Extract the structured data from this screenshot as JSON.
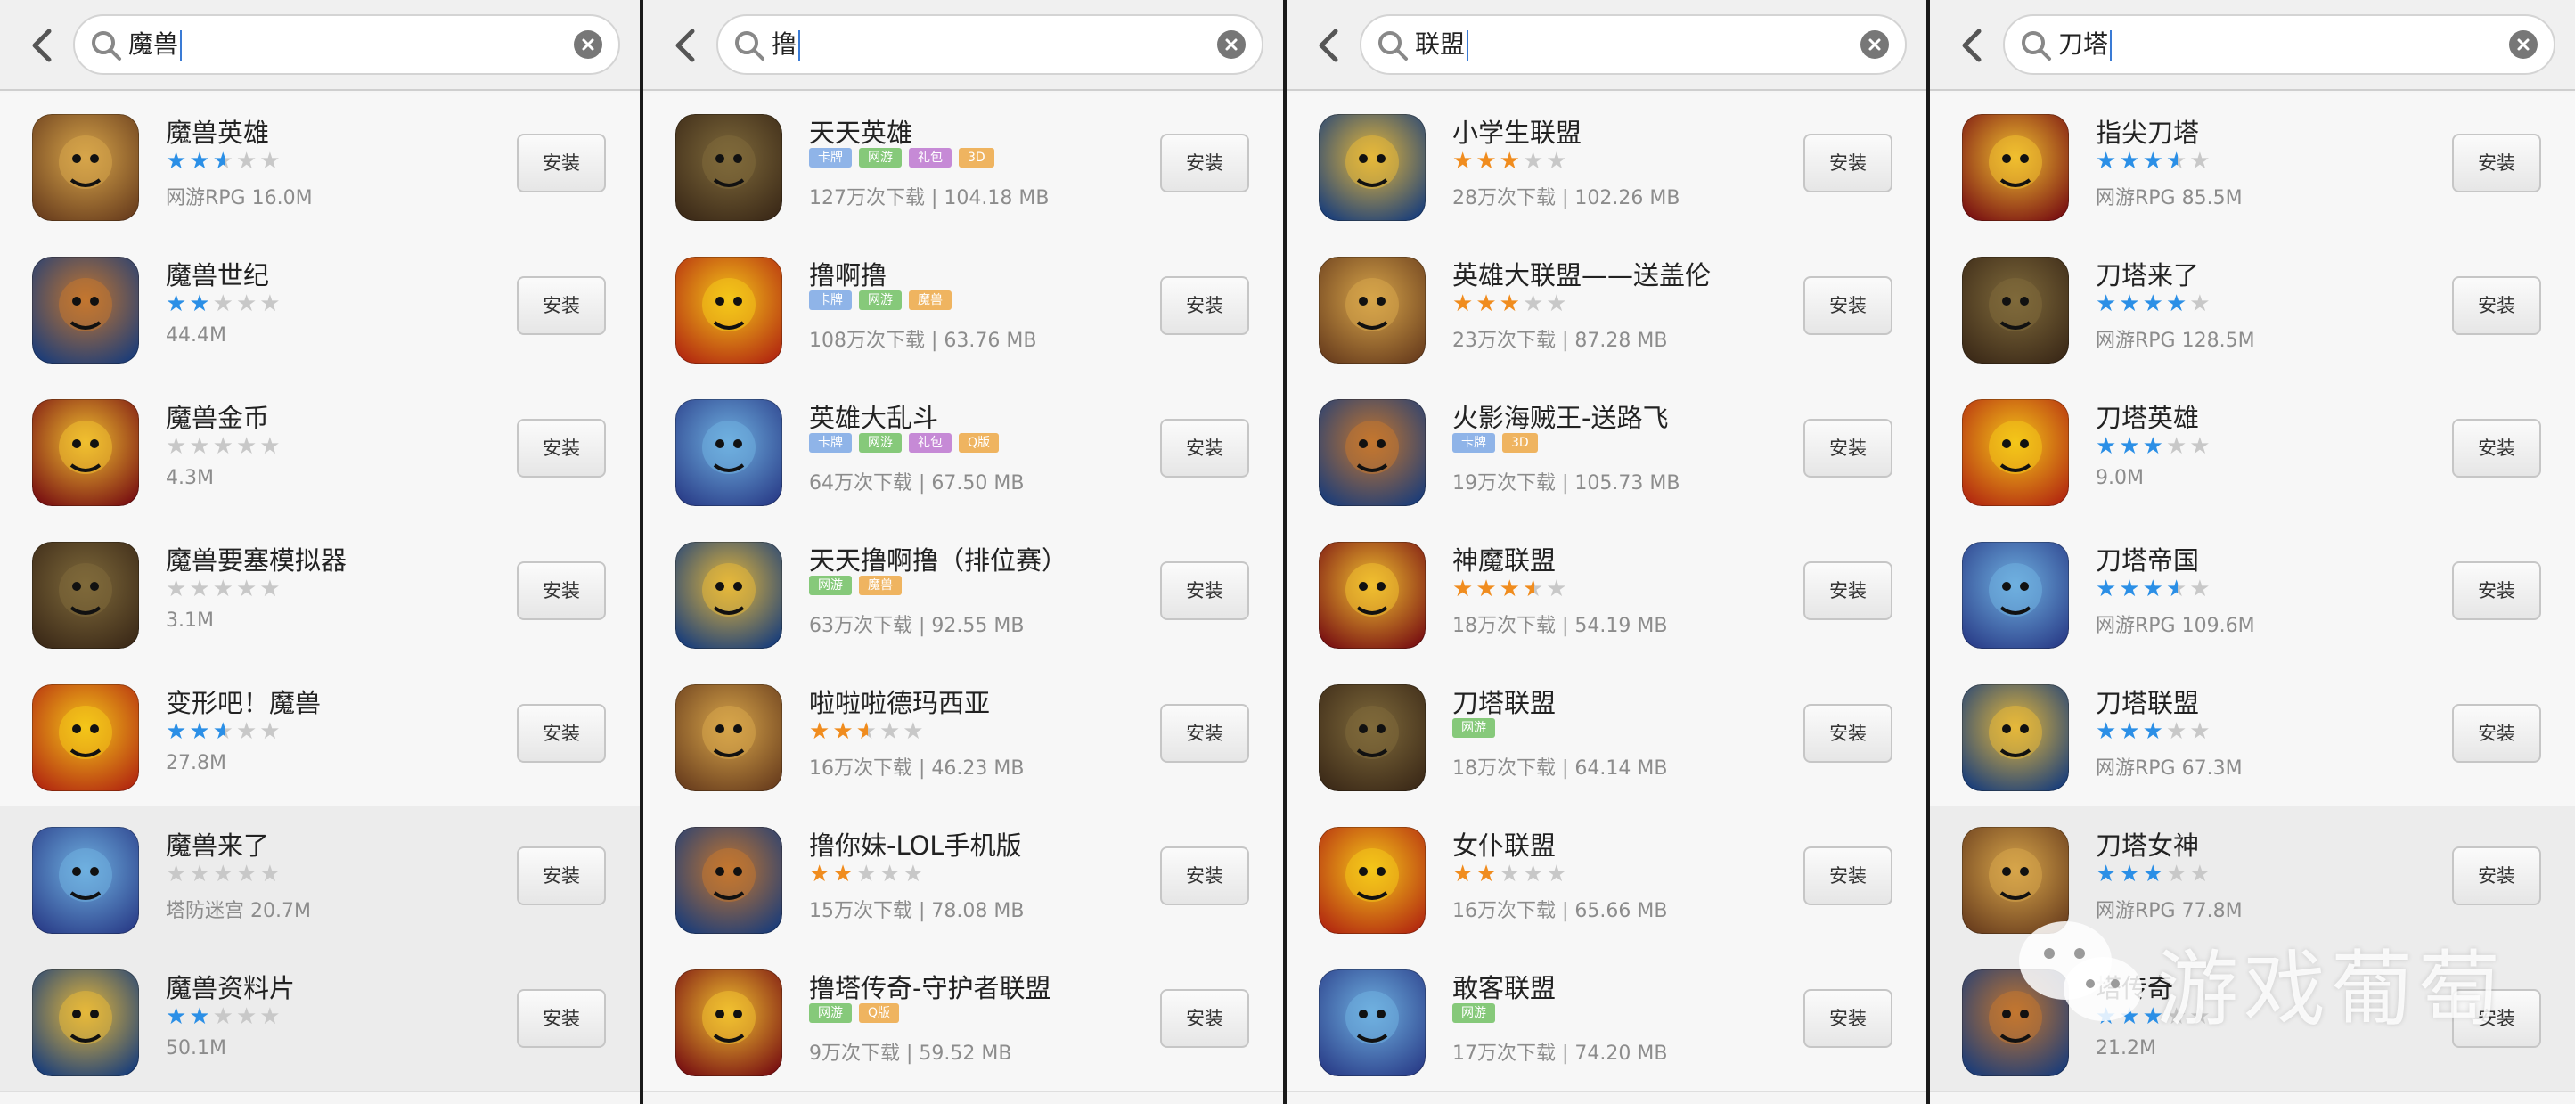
{
  "install_label": "安装",
  "colors": {
    "star_blue": "#2b8fe6",
    "star_orange": "#f08c1e",
    "star_empty": "#c8c8c8",
    "tag_blue": "#8fb4e8",
    "tag_green": "#86c97a",
    "tag_purple": "#c68ad6",
    "tag_orange": "#efb460"
  },
  "panels": [
    {
      "query": "魔兽",
      "items": [
        {
          "name": "魔兽英雄",
          "rating": 2.5,
          "meta": "网游RPG 16.0M",
          "tags": [],
          "icon": "panda-warrior-icon"
        },
        {
          "name": "魔兽世纪",
          "rating": 2,
          "meta": "44.4M",
          "tags": [],
          "icon": "armored-hero-icon"
        },
        {
          "name": "魔兽金币",
          "rating": 0,
          "meta": "4.3M",
          "tags": [],
          "icon": "gold-coin-icon"
        },
        {
          "name": "魔兽要塞模拟器",
          "rating": 0,
          "meta": "3.1M",
          "tags": [],
          "icon": "fortress-icon"
        },
        {
          "name": "变形吧！魔兽",
          "rating": 2.5,
          "meta": "27.8M",
          "tags": [],
          "icon": "dragon-eye-icon"
        },
        {
          "name": "魔兽来了",
          "rating": 0,
          "meta": "塔防迷宫 20.7M",
          "tags": [],
          "icon": "werewolf-icon"
        },
        {
          "name": "魔兽资料片",
          "rating": 2,
          "meta": "50.1M",
          "tags": [],
          "icon": "warcraft-w-icon"
        }
      ]
    },
    {
      "query": "撸",
      "items": [
        {
          "name": "天天英雄",
          "rating": null,
          "meta": "127万次下载 | 104.18 MB",
          "tags": [
            "卡牌",
            "网游",
            "礼包",
            "3D"
          ],
          "icon": "heroine-red-hair-icon"
        },
        {
          "name": "撸啊撸",
          "rating": null,
          "meta": "108万次下载 | 63.76 MB",
          "tags": [
            "卡牌",
            "网游",
            "魔兽"
          ],
          "icon": "lol-emblem-icon"
        },
        {
          "name": "英雄大乱斗",
          "rating": null,
          "meta": "64万次下载 | 67.50 MB",
          "tags": [
            "卡牌",
            "网游",
            "礼包",
            "Q版"
          ],
          "icon": "blue-l-emblem-icon"
        },
        {
          "name": "天天撸啊撸（排位赛）",
          "rating": null,
          "meta": "63万次下载 | 92.55 MB",
          "tags": [
            "网游",
            "魔兽"
          ],
          "icon": "armored-knight-icon"
        },
        {
          "name": "啦啦啦德玛西亚",
          "rating": 2.5,
          "meta": "16万次下载 | 46.23 MB",
          "tags": [],
          "icon": "lol-emblem-gold-icon"
        },
        {
          "name": "撸你妹-LOL手机版",
          "rating": 2,
          "meta": "15万次下载 | 78.08 MB",
          "tags": [],
          "icon": "cute-witch-icon"
        },
        {
          "name": "撸塔传奇-守护者联盟",
          "rating": null,
          "meta": "9万次下载 | 59.52 MB",
          "tags": [
            "网游",
            "Q版"
          ],
          "icon": "red-monster-icon"
        }
      ]
    },
    {
      "query": "联盟",
      "items": [
        {
          "name": "小学生联盟",
          "rating": 3,
          "meta": "28万次下载 | 102.26 MB",
          "tags": [],
          "icon": "blonde-warrior-icon"
        },
        {
          "name": "英雄大联盟——送盖伦",
          "rating": 3,
          "meta": "23万次下载 | 87.28 MB",
          "tags": [],
          "icon": "red-hair-girl-icon"
        },
        {
          "name": "火影海贼王-送路飞",
          "rating": null,
          "meta": "19万次下载 | 105.73 MB",
          "tags": [
            "卡牌",
            "3D"
          ],
          "icon": "ninja-pirate-icon"
        },
        {
          "name": "神魔联盟",
          "rating": 3.5,
          "meta": "18万次下载 | 54.19 MB",
          "tags": [],
          "icon": "demon-horned-icon"
        },
        {
          "name": "刀塔联盟",
          "rating": null,
          "meta": "18万次下载 | 64.14 MB",
          "tags": [
            "网游"
          ],
          "icon": "blonde-girl-icon"
        },
        {
          "name": "女仆联盟",
          "rating": 2,
          "meta": "16万次下载 | 65.66 MB",
          "tags": [],
          "icon": "miku-girl-icon"
        },
        {
          "name": "敢客联盟",
          "rating": null,
          "meta": "17万次下载 | 74.20 MB",
          "tags": [
            "网游"
          ],
          "icon": "teemo-icon"
        }
      ]
    },
    {
      "query": "刀塔",
      "items": [
        {
          "name": "指尖刀塔",
          "rating": 3.5,
          "meta": "网游RPG 85.5M",
          "tags": [],
          "icon": "chibi-hero-icon"
        },
        {
          "name": "刀塔来了",
          "rating": 4,
          "meta": "网游RPG 128.5M",
          "tags": [],
          "icon": "purple-mage-icon"
        },
        {
          "name": "刀塔英雄",
          "rating": 3,
          "meta": "9.0M",
          "tags": [],
          "icon": "dota-logo-icon"
        },
        {
          "name": "刀塔帝国",
          "rating": 3.5,
          "meta": "网游RPG 109.6M",
          "tags": [],
          "icon": "fire-goddess-icon"
        },
        {
          "name": "刀塔联盟",
          "rating": 3,
          "meta": "网游RPG 67.3M",
          "tags": [],
          "icon": "blonde-girl-icon"
        },
        {
          "name": "刀塔女神",
          "rating": 3,
          "meta": "网游RPG 77.8M",
          "tags": [],
          "icon": "pink-hair-girl-icon"
        },
        {
          "name": "塔传奇",
          "rating": 3,
          "meta": "21.2M",
          "tags": [],
          "icon": "dark-warrior-icon"
        }
      ]
    }
  ],
  "watermark": {
    "text": "游戏葡萄",
    "icon": "wechat-logo-icon"
  }
}
